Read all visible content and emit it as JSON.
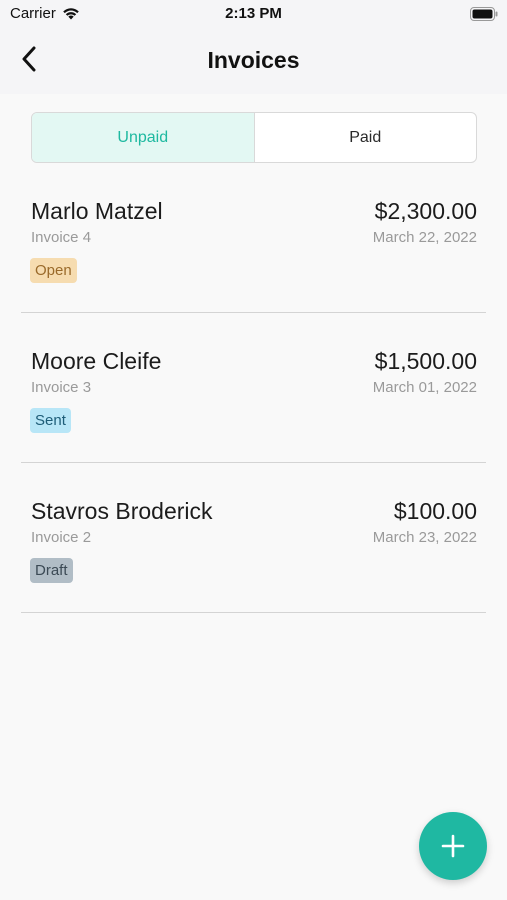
{
  "status_bar": {
    "carrier": "Carrier",
    "time": "2:13 PM"
  },
  "nav": {
    "title": "Invoices"
  },
  "tabs": [
    {
      "label": "Unpaid",
      "active": true
    },
    {
      "label": "Paid",
      "active": false
    }
  ],
  "invoices": [
    {
      "name": "Marlo Matzel",
      "number": "Invoice 4",
      "amount": "$2,300.00",
      "date": "March 22, 2022",
      "status": "Open"
    },
    {
      "name": "Moore Cleife",
      "number": "Invoice 3",
      "amount": "$1,500.00",
      "date": "March 01, 2022",
      "status": "Sent"
    },
    {
      "name": "Stavros Broderick",
      "number": "Invoice 2",
      "amount": "$100.00",
      "date": "March 23, 2022",
      "status": "Draft"
    }
  ],
  "status_colors": {
    "Open": {
      "bg": "#f6dcb0",
      "fg": "#9a6a2a"
    },
    "Sent": {
      "bg": "#b8e6f7",
      "fg": "#1e5d78"
    },
    "Draft": {
      "bg": "#b1bdc6",
      "fg": "#3c4a55"
    }
  },
  "accent_color": "#1fb8a2",
  "icons": {
    "back": "chevron-left-icon",
    "add": "plus-icon"
  }
}
